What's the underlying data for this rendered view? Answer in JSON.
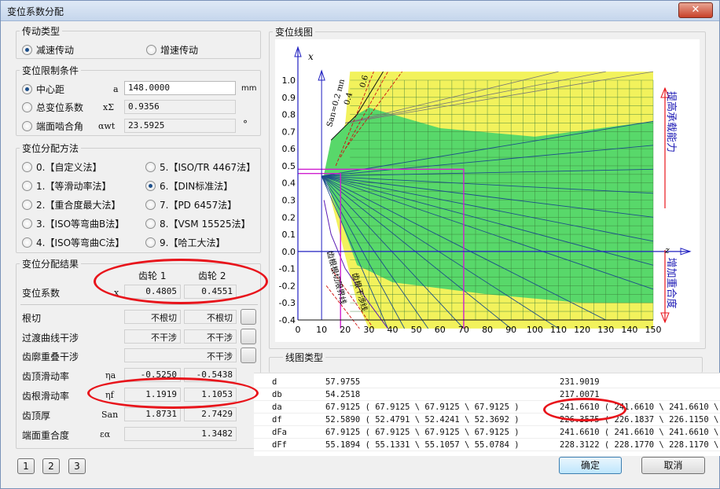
{
  "window": {
    "title": "变位系数分配",
    "close": "✕"
  },
  "drive": {
    "title": "传动类型",
    "opt1": "减速传动",
    "opt2": "增速传动"
  },
  "limit": {
    "title": "变位限制条件",
    "r1": "中心距",
    "r1sym": "a",
    "r1val": "148.0000",
    "r1unit": "mm",
    "r2": "总变位系数",
    "r2sym": "xΣ",
    "r2val": "0.9356",
    "r3": "端面啮合角",
    "r3sym": "αwt",
    "r3val": "23.5925",
    "r3unit": "°"
  },
  "method": {
    "title": "变位分配方法",
    "items": [
      "0.【自定义法】",
      "1.【等滑动率法】",
      "2.【重合度最大法】",
      "3.【ISO等弯曲B法】",
      "4.【ISO等弯曲C法】",
      "5.【ISO/TR 4467法】",
      "6.【DIN标准法】",
      "7.【PD 6457法】",
      "8.【VSM 15525法】",
      "9.【哈工大法】"
    ]
  },
  "result": {
    "title": "变位分配结果",
    "gear1": "齿轮 1",
    "gear2": "齿轮 2",
    "coef": {
      "label": "变位系数",
      "sym": "x",
      "v1": "0.4805",
      "v2": "0.4551"
    },
    "undercut": {
      "label": "根切",
      "v1": "不根切",
      "v2": "不根切"
    },
    "trans": {
      "label": "过渡曲线干涉",
      "v1": "不干涉",
      "v2": "不干涉"
    },
    "overlap": {
      "label": "齿廓重叠干涉",
      "v2": "不干涉"
    },
    "tipslide": {
      "label": "齿顶滑动率",
      "sym": "ηa",
      "v1": "-0.5250",
      "v2": "-0.5438"
    },
    "rootslide": {
      "label": "齿根滑动率",
      "sym": "ηf",
      "v1": "1.1919",
      "v2": "1.1053"
    },
    "tipthick": {
      "label": "齿顶厚",
      "sym": "San",
      "v1": "1.8731",
      "v2": "2.7429"
    },
    "contact": {
      "label": "端面重合度",
      "sym": "εα",
      "v": "1.3482"
    }
  },
  "chart_panel": {
    "title": "变位线图",
    "linetype": "线图类型"
  },
  "chart_data": {
    "type": "line",
    "xlabel": "x",
    "ylabel2": "z",
    "xlim": [
      0,
      150
    ],
    "ylim": [
      -0.45,
      1.05
    ],
    "xticks": [
      "0",
      "10",
      "20",
      "30",
      "40",
      "50",
      "60",
      "70",
      "80",
      "90",
      "100",
      "110",
      "120",
      "130",
      "140",
      "150"
    ],
    "yticks": [
      "1.0",
      "0.9",
      "0.8",
      "0.7",
      "0.6",
      "0.5",
      "0.4",
      "0.3",
      "0.2",
      "0.1",
      "0.0",
      "-0.1",
      "-0.2",
      "-0.3",
      "-0.4"
    ],
    "annot_up": "提高承载能力",
    "annot_down": "增加重合度",
    "annot_san": "San=0.2 mn",
    "annot_san2": "0.4",
    "annot_san3": "0.6",
    "annot_limit1": "齿根根切限界线",
    "annot_limit2": "齿根干涉线"
  },
  "table": {
    "rows": [
      [
        "d",
        "57.9755",
        "231.9019"
      ],
      [
        "db",
        "54.2518",
        "217.0071"
      ],
      [
        "da",
        "67.9125 ( 67.9125 \\ 67.9125 \\ 67.9125 )",
        "241.6610 ( 241.6610 \\ 241.6610 \\ 24"
      ],
      [
        "df",
        "52.5890 ( 52.4791 \\ 52.4241 \\ 52.3692 )",
        "226.3575 ( 226.1837 \\ 226.1150 \\ 22"
      ],
      [
        "dFa",
        "67.9125 ( 67.9125 \\ 67.9125 \\ 67.9125 )",
        "241.6610 ( 241.6610 \\ 241.6610 \\ 24"
      ],
      [
        "dFf",
        "55.1894 ( 55.1331 \\ 55.1057 \\ 55.0784 )",
        "228.3122 ( 228.1770 \\ 228.1170 \\ 22"
      ]
    ]
  },
  "buttons": {
    "b1": "1",
    "b2": "2",
    "b3": "3",
    "ok": "确定",
    "cancel": "取消"
  }
}
